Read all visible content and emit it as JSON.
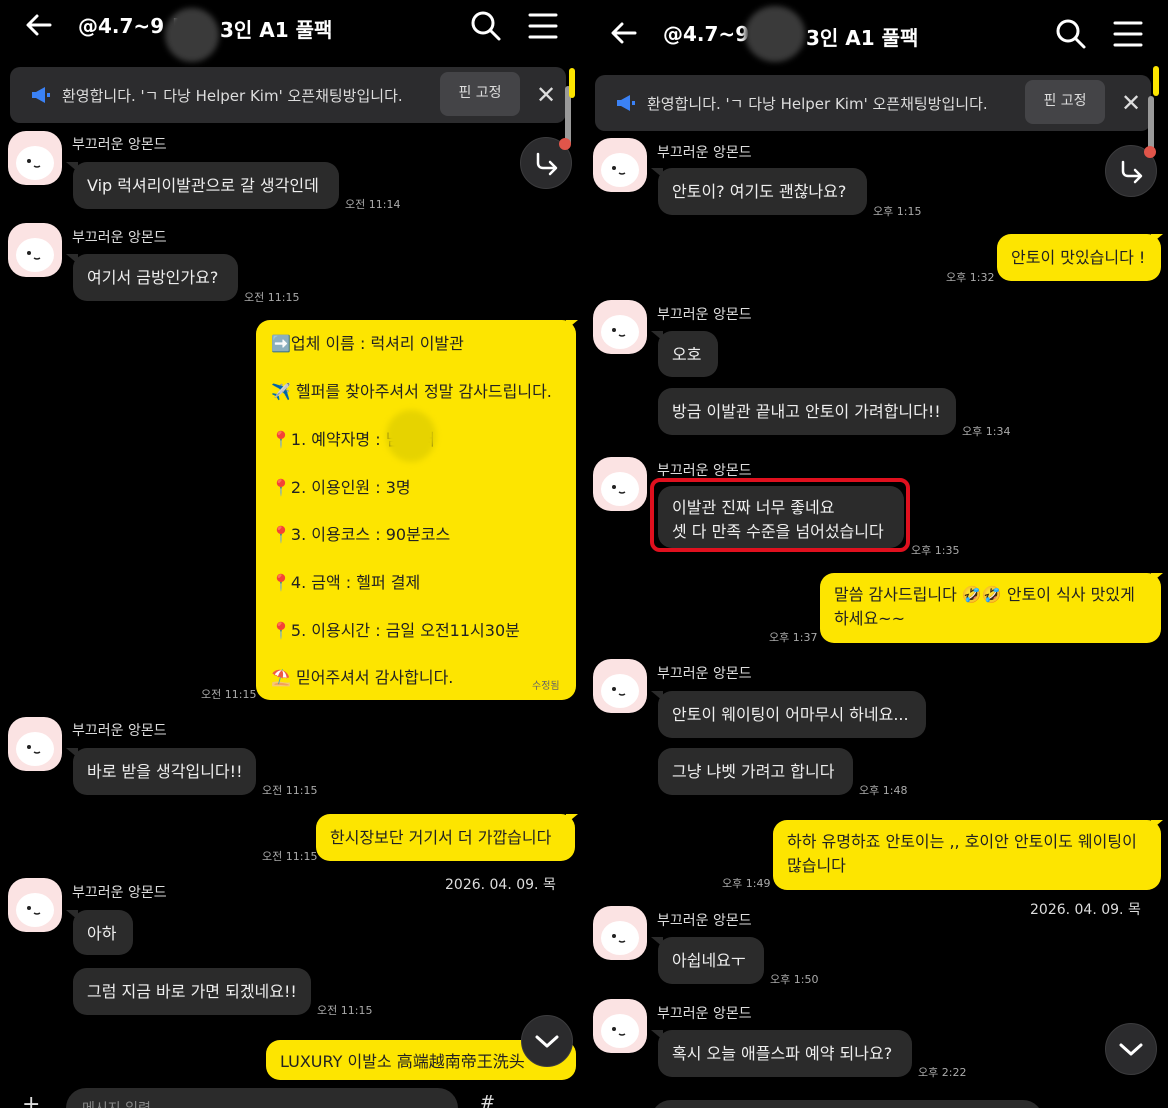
{
  "left": {
    "header": {
      "title_a": "@4.7~9 !",
      "title_b": "3인 A1 풀팩"
    },
    "notice": {
      "text": "환영합니다. 'ㄱ 다낭 Helper Kim' 오픈채팅방입니다.",
      "pin_label": "핀 고정"
    },
    "sender": "부끄러운 앙몬드",
    "messages": {
      "m1": "Vip 럭셔리이발관으로 갈 생각인데",
      "t1": "오전 11:14",
      "m2": "여기서 금방인가요?",
      "t2": "오전 11:15",
      "card": {
        "lines": [
          "➡️업체 이름 : 럭셔리 이발관",
          "✈️ 헬퍼를 찾아주셔서 정말 감사드립니다.",
          "📍1. 예약자명 :         님 헬퍼",
          "📍2. 이용인원 :  3명",
          "📍3. 이용코스 :  90분코스",
          "📍4. 금액 : 헬퍼 결제",
          "📍5. 이용시간 : 금일 오전11시30분",
          "⛱️ 믿어주셔서 감사합니다."
        ],
        "edited": "수정됨",
        "time": "오전 11:15"
      },
      "m3": "바로 받을 생각입니다!!",
      "t3": "오전 11:15",
      "m4": "한시장보단 거기서 더  가깝습니다",
      "t4": "오전 11:15",
      "date": "2026. 04. 09. 목",
      "m5": "아하",
      "m6": "그럼 지금 바로 가면 되겠네요!!",
      "t6": "오전 11:15",
      "m7": "LUXURY 이발소 高端越南帝王洗头"
    }
  },
  "right": {
    "header": {
      "title_a": "@4.7~9",
      "title_b": "3인 A1 풀팩"
    },
    "notice": {
      "text": "환영합니다. 'ㄱ 다낭 Helper Kim' 오픈채팅방입니다.",
      "pin_label": "핀 고정"
    },
    "sender": "부끄러운 앙몬드",
    "messages": {
      "r1": "안토이? 여기도 괜찮나요?",
      "rt1": "오후 1:15",
      "r2": "안토이 맛있습니다 !",
      "rt2": "오후 1:32",
      "r3": "오호",
      "r4": "방금 이발관 끝내고 안토이 가려합니다!!",
      "rt4": "오후 1:34",
      "r5a": "이발관 진짜 너무 좋네요",
      "r5b": "셋 다 만족 수준을 넘어섰습니다",
      "rt5": "오후 1:35",
      "r6a": "말씀 감사드립니다 🤣🤣 안토이 식사 맛있게",
      "r6b": "하세요~~",
      "rt6": "오후 1:37",
      "r7": "안토이 웨이팅이 어마무시 하네요...",
      "r8": "그냥 냐벳 가려고 합니다",
      "rt8": "오후 1:48",
      "r9a": "하하 유명하죠 안토이는 ,, 호이안 안토이도 웨이팅이",
      "r9b": "많습니다",
      "rt9": "오후 1:49",
      "date": "2026. 04. 09. 목",
      "r10": "아쉽네요ㅜ",
      "rt10": "오후 1:50",
      "r11": "혹시 오늘 애플스파 예약 되나요?",
      "rt11": "오후 2:22"
    }
  },
  "input": {
    "placeholder": "메시지 입력"
  },
  "colors": {
    "my_bubble": "#fde500",
    "other_bubble": "#2b2b2b",
    "background": "#000000",
    "highlight": "#e0101e"
  }
}
